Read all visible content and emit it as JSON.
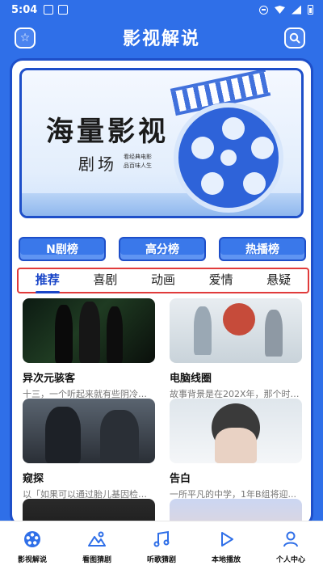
{
  "status_bar": {
    "time": "5:04"
  },
  "header": {
    "title": "影视解说"
  },
  "banner": {
    "title_line1": "海量影视",
    "title_line2": "剧场",
    "tagline_1": "看经典电影",
    "tagline_2": "品百味人生"
  },
  "rank_buttons": [
    "N剧榜",
    "高分榜",
    "热播榜"
  ],
  "tabs": [
    {
      "label": "推荐",
      "active": true
    },
    {
      "label": "喜剧",
      "active": false
    },
    {
      "label": "动画",
      "active": false
    },
    {
      "label": "爱情",
      "active": false
    },
    {
      "label": "悬疑",
      "active": false
    }
  ],
  "cards": [
    {
      "title": "异次元骇客",
      "desc": "十三，一个听起来就有些阴冷的..."
    },
    {
      "title": "电脑线圈",
      "desc": "故事背景是在202X年，那个时候..."
    },
    {
      "title": "窥探",
      "desc": "以「如果可以通过胎儿基因检测..."
    },
    {
      "title": "告白",
      "desc": "一所平凡的中学，1年B组将迎..."
    }
  ],
  "bottom_nav": [
    {
      "label": "影视解说",
      "icon": "film-reel-icon"
    },
    {
      "label": "看图猜剧",
      "icon": "image-icon"
    },
    {
      "label": "听歌猜剧",
      "icon": "music-note-icon"
    },
    {
      "label": "本地播放",
      "icon": "play-icon"
    },
    {
      "label": "个人中心",
      "icon": "person-icon"
    }
  ],
  "colors": {
    "primary": "#2f6fe8",
    "dark_primary": "#1e4fc9",
    "tab_box": "#e03b3b"
  }
}
